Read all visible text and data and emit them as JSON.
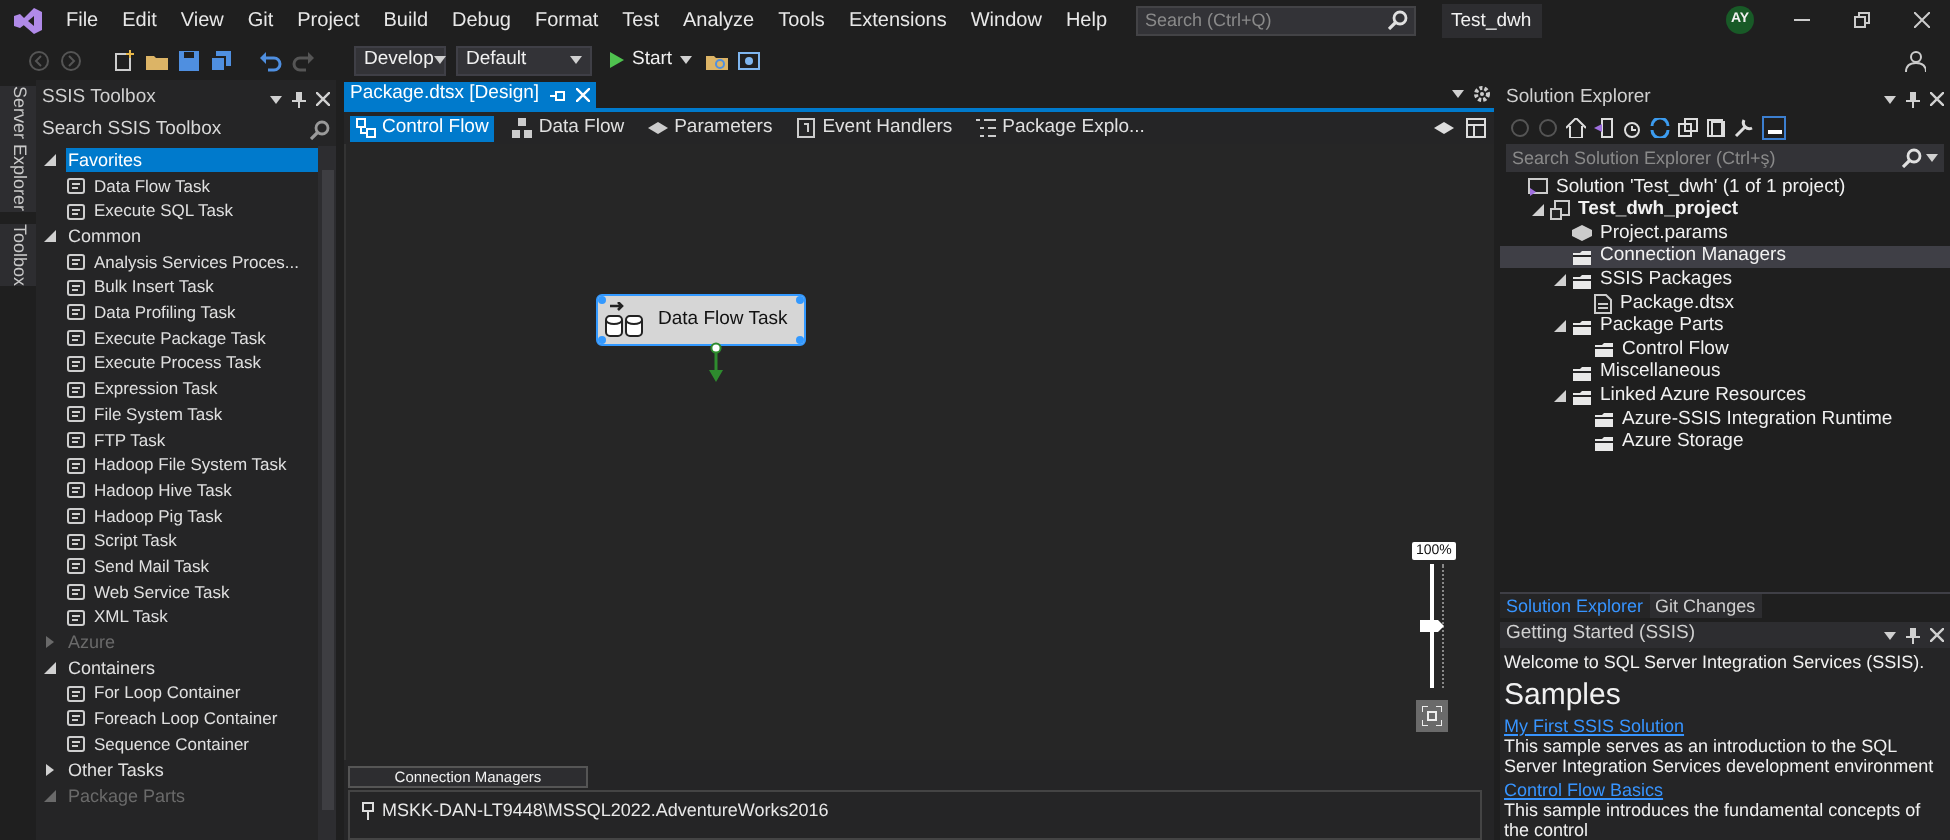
{
  "menu_bar": {
    "items": [
      "File",
      "Edit",
      "View",
      "Git",
      "Project",
      "Build",
      "Debug",
      "Format",
      "Test",
      "Analyze",
      "Tools",
      "Extensions",
      "Window",
      "Help"
    ],
    "search": {
      "placeholder": "Search (Ctrl+Q)"
    },
    "solution_name": "Test_dwh",
    "avatar": "AY"
  },
  "toolbar": {
    "configuration": "Develop",
    "platform": "Default",
    "start": "Start"
  },
  "side_tabs": [
    "Server Explorer",
    "Toolbox"
  ],
  "toolbox": {
    "title": "SSIS Toolbox",
    "search": {
      "placeholder": "Search SSIS Toolbox"
    },
    "sections": [
      {
        "label": "Favorites",
        "expanded": true,
        "disabled": false,
        "selected": true,
        "items": [
          "Data Flow Task",
          "Execute SQL Task"
        ]
      },
      {
        "label": "Common",
        "expanded": true,
        "disabled": false,
        "selected": false,
        "items": [
          "Analysis Services Proces...",
          "Bulk Insert Task",
          "Data Profiling Task",
          "Execute Package Task",
          "Execute Process Task",
          "Expression Task",
          "File System Task",
          "FTP Task",
          "Hadoop File System Task",
          "Hadoop Hive Task",
          "Hadoop Pig Task",
          "Script Task",
          "Send Mail Task",
          "Web Service Task",
          "XML Task"
        ]
      },
      {
        "label": "Azure",
        "expanded": false,
        "disabled": true,
        "selected": false
      },
      {
        "label": "Containers",
        "expanded": true,
        "disabled": false,
        "selected": false,
        "items": [
          "For Loop Container",
          "Foreach Loop Container",
          "Sequence Container"
        ]
      },
      {
        "label": "Other Tasks",
        "expanded": false,
        "disabled": false,
        "selected": false
      },
      {
        "label": "Package Parts",
        "expanded": true,
        "disabled": true,
        "selected": false
      }
    ]
  },
  "designer": {
    "tab": {
      "label": "Package.dtsx [Design]",
      "selected": true
    },
    "views": [
      {
        "label": "Control Flow",
        "selected": true
      },
      {
        "label": "Data Flow",
        "selected": false
      },
      {
        "label": "Parameters",
        "selected": false
      },
      {
        "label": "Event Handlers",
        "selected": false
      },
      {
        "label": "Package Explo...",
        "selected": false
      }
    ],
    "task": {
      "label": "Data Flow Task",
      "selected": true
    },
    "zoom": {
      "reading": "100%",
      "level": 0.5
    },
    "connection_managers": {
      "title": "Connection Managers",
      "items": [
        "MSKK-DAN-LT9448\\MSSQL2022.AdventureWorks2016"
      ]
    }
  },
  "solution_explorer": {
    "title": "Solution Explorer",
    "search": {
      "placeholder": "Search Solution Explorer (Ctrl+ş)"
    },
    "tree": [
      {
        "label": "Solution 'Test_dwh' (1 of 1 project)",
        "kind": "solution",
        "selected": false,
        "children": [
          {
            "label": "Test_dwh_project",
            "kind": "project",
            "expanded": true,
            "selected": false,
            "children": [
              {
                "label": "Project.params",
                "kind": "params",
                "selected": false
              },
              {
                "label": "Connection Managers",
                "kind": "folder",
                "selected": true
              },
              {
                "label": "SSIS Packages",
                "kind": "folder",
                "expanded": true,
                "selected": false,
                "children": [
                  {
                    "label": "Package.dtsx",
                    "kind": "file",
                    "selected": false
                  }
                ]
              },
              {
                "label": "Package Parts",
                "kind": "folder",
                "expanded": true,
                "selected": false,
                "children": [
                  {
                    "label": "Control Flow",
                    "kind": "folder",
                    "selected": false
                  }
                ]
              },
              {
                "label": "Miscellaneous",
                "kind": "folder",
                "selected": false
              },
              {
                "label": "Linked Azure Resources",
                "kind": "folder",
                "expanded": true,
                "selected": false,
                "children": [
                  {
                    "label": "Azure-SSIS Integration Runtime",
                    "kind": "folder",
                    "selected": false
                  },
                  {
                    "label": "Azure Storage",
                    "kind": "folder",
                    "selected": false
                  }
                ]
              }
            ]
          }
        ]
      }
    ],
    "tabs": [
      {
        "label": "Solution Explorer",
        "selected": true
      },
      {
        "label": "Git Changes",
        "selected": false
      }
    ]
  },
  "getting_started": {
    "title": "Getting Started (SSIS)",
    "welcome": "Welcome to SQL Server Integration Services (SSIS).",
    "heading": "Samples",
    "samples": [
      {
        "link": "My First SSIS Solution",
        "description": "This sample serves as an introduction to the SQL Server Integration Services development environment"
      },
      {
        "link": "Control Flow Basics",
        "description": "This sample introduces the fundamental concepts of the control"
      }
    ]
  }
}
